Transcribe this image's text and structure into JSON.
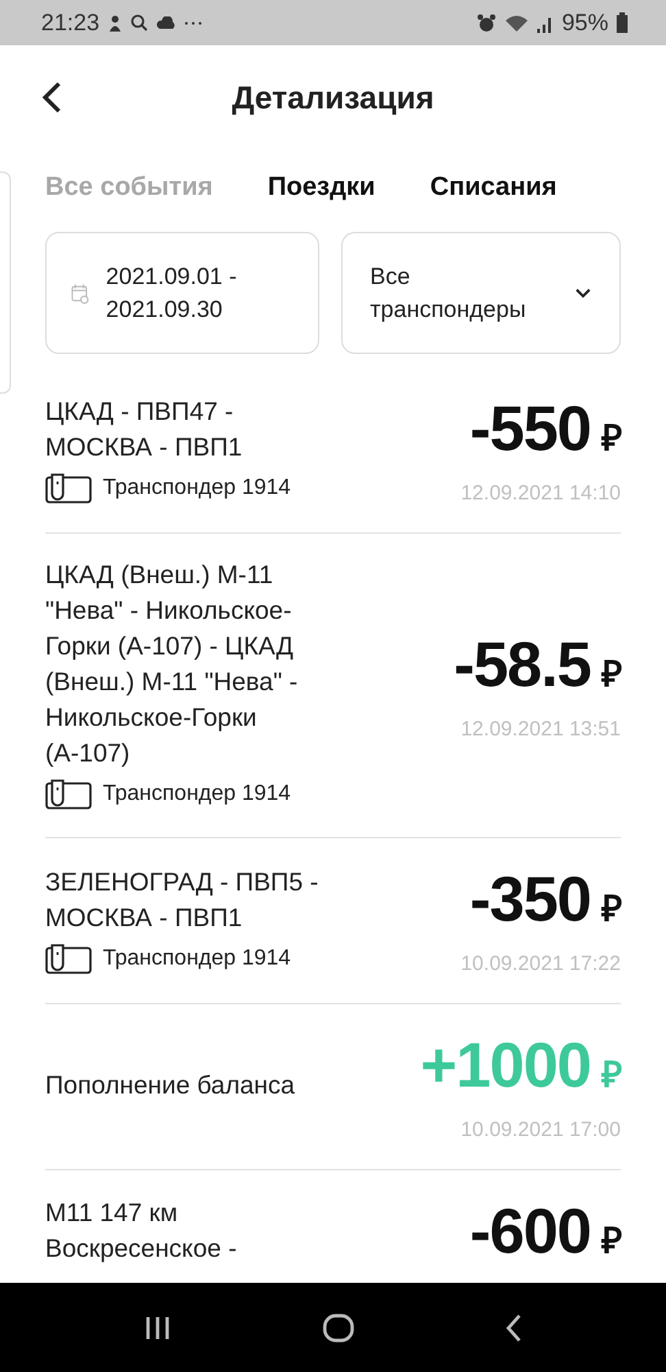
{
  "status_bar": {
    "time": "21:23",
    "battery": "95%"
  },
  "header": {
    "title": "Детализация"
  },
  "tabs": [
    {
      "label": "Все события",
      "selected": true
    },
    {
      "label": "Поездки",
      "selected": false
    },
    {
      "label": "Списания",
      "selected": false
    }
  ],
  "filters": {
    "date_range": "2021.09.01 - 2021.09.30",
    "transponder": "Все транспондеры"
  },
  "events": [
    {
      "title": "ЦКАД - ПВП47 - МОСКВА - ПВП1",
      "transponder": "Транспондер 1914",
      "amount": "-550",
      "currency": "₽",
      "kind": "debit",
      "datetime": "12.09.2021 14:10"
    },
    {
      "title": "ЦКАД (Внеш.) М-11 \"Нева\" - Никольское-Горки (А-107) - ЦКАД (Внеш.) М-11 \"Нева\" - Никольское-Горки (А-107)",
      "transponder": "Транспондер 1914",
      "amount": "-58.5",
      "currency": "₽",
      "kind": "debit",
      "datetime": "12.09.2021 13:51"
    },
    {
      "title": "ЗЕЛЕНОГРАД - ПВП5 - МОСКВА - ПВП1",
      "transponder": "Транспондер 1914",
      "amount": "-350",
      "currency": "₽",
      "kind": "debit",
      "datetime": "10.09.2021 17:22"
    },
    {
      "title": "Пополнение баланса",
      "amount": "+1000",
      "currency": "₽",
      "kind": "credit",
      "datetime": "10.09.2021 17:00"
    },
    {
      "title": "М11 147 км Воскресенское -",
      "amount": "-600",
      "currency": "₽",
      "kind": "debit"
    }
  ]
}
